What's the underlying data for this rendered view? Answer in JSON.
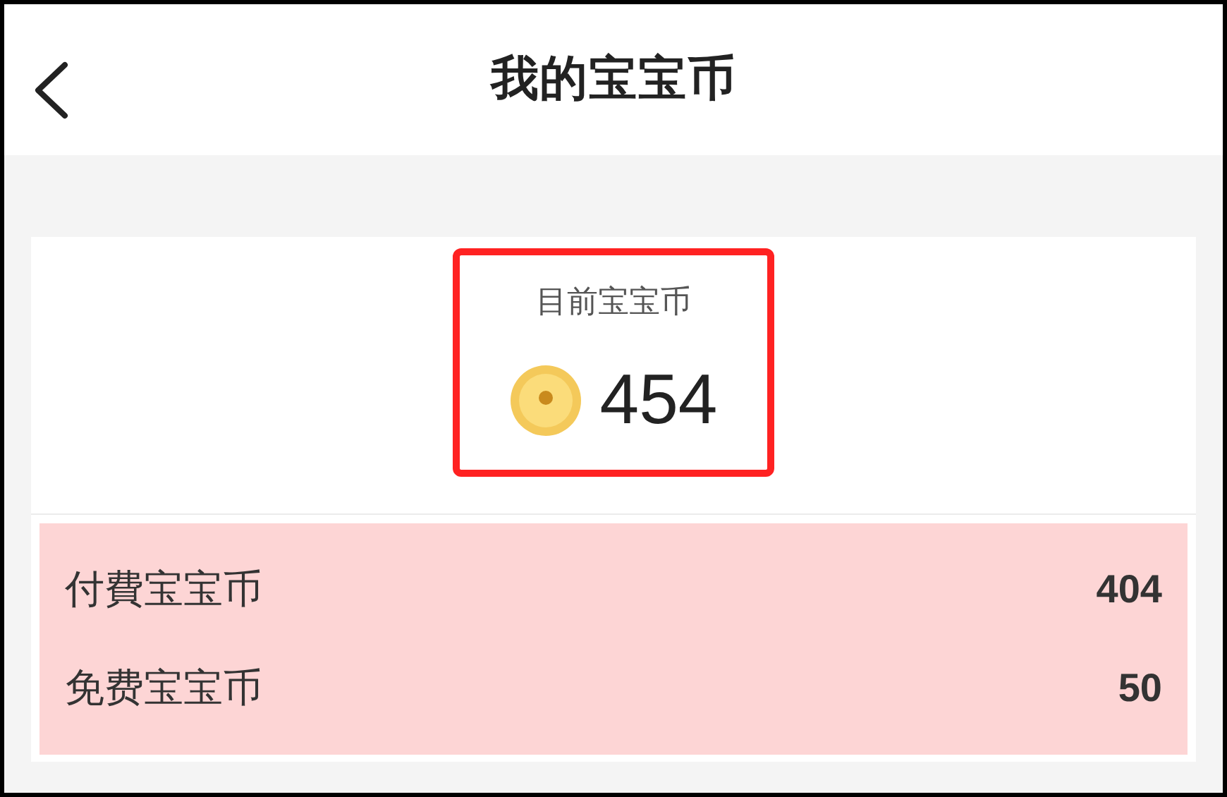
{
  "header": {
    "title": "我的宝宝币"
  },
  "balance": {
    "label": "目前宝宝币",
    "amount": "454"
  },
  "breakdown": [
    {
      "label": "付費宝宝币",
      "value": "404"
    },
    {
      "label": "免费宝宝币",
      "value": "50"
    }
  ]
}
